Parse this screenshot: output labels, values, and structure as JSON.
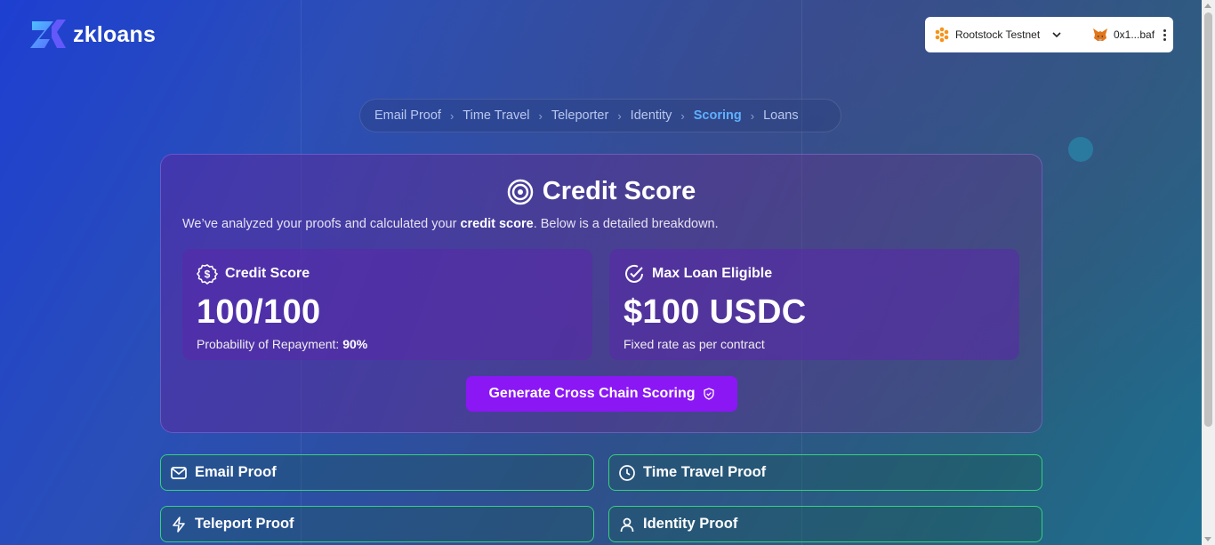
{
  "brand": {
    "name": "zkloans"
  },
  "wallet": {
    "network": "Rootstock Testnet",
    "account": "0x1...baf",
    "network_icon": "rootstock-icon",
    "account_icon": "metamask-fox-icon"
  },
  "breadcrumb": [
    {
      "label": "Email Proof",
      "active": false
    },
    {
      "label": "Time Travel",
      "active": false
    },
    {
      "label": "Teleporter",
      "active": false
    },
    {
      "label": "Identity",
      "active": false
    },
    {
      "label": "Scoring",
      "active": true
    },
    {
      "label": "Loans",
      "active": false
    }
  ],
  "score_card": {
    "title": "Credit Score",
    "subtitle_pre": "We’ve analyzed your proofs and calculated your ",
    "subtitle_bold": "credit score",
    "subtitle_post": ". Below is a detailed breakdown.",
    "credit": {
      "label": "Credit Score",
      "value": "100/100",
      "note_pre": "Probability of Repayment: ",
      "note_bold": "90%"
    },
    "loan": {
      "label": "Max Loan Eligible",
      "value": "$100 USDC",
      "note": "Fixed rate as per contract"
    },
    "button": "Generate Cross Chain Scoring"
  },
  "proofs": [
    {
      "label": "Email Proof",
      "icon": "mail-icon"
    },
    {
      "label": "Time Travel Proof",
      "icon": "clock-icon"
    },
    {
      "label": "Teleport Proof",
      "icon": "lightning-icon"
    },
    {
      "label": "Identity Proof",
      "icon": "user-icon"
    }
  ],
  "colors": {
    "accent": "#8b17f5",
    "active_crumb": "#5fb0ff",
    "proof_border": "#35d07f"
  }
}
